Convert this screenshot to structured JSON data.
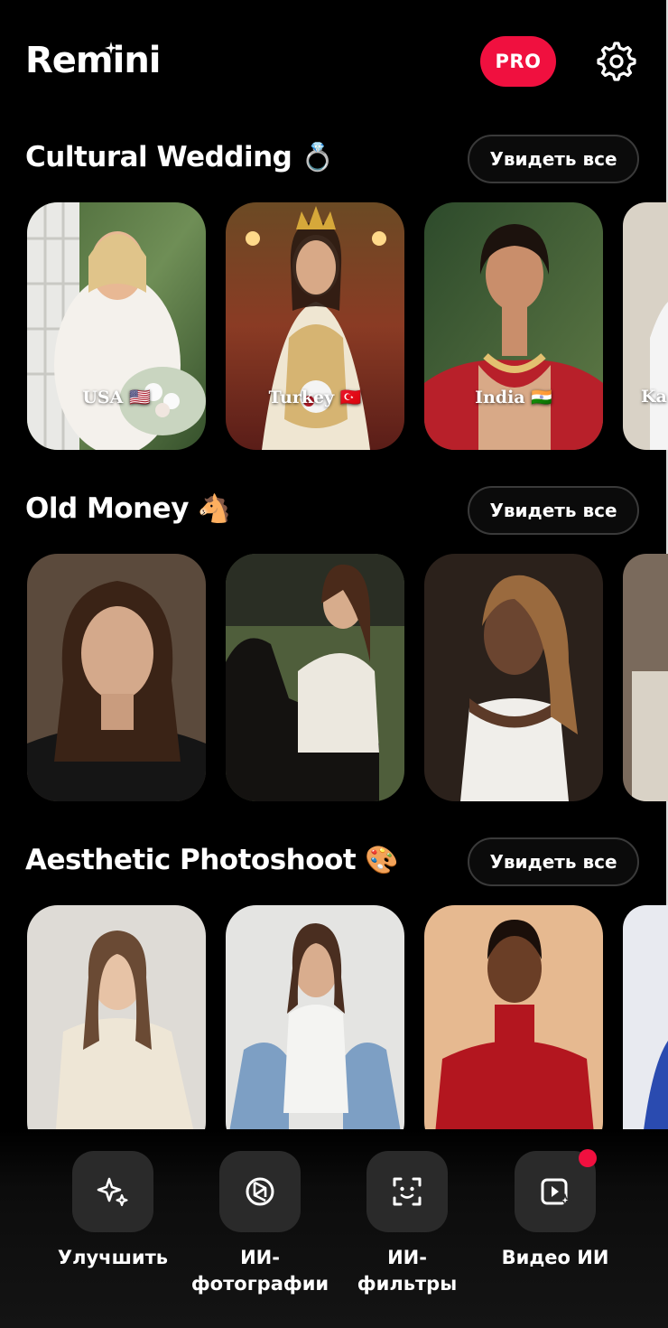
{
  "header": {
    "app_name": "Remini",
    "pro_label": "PRO",
    "settings_icon": "gear-icon"
  },
  "sections": [
    {
      "title": "Cultural Wedding",
      "emoji": "💍",
      "see_all": "Увидеть все",
      "cards": [
        {
          "label": "USA 🇺🇸"
        },
        {
          "label": "Turkey 🇹🇷"
        },
        {
          "label": "India 🇮🇳"
        },
        {
          "label": "Ka"
        }
      ]
    },
    {
      "title": "Old Money",
      "emoji": "🐴",
      "see_all": "Увидеть все",
      "cards": [
        {
          "label": ""
        },
        {
          "label": ""
        },
        {
          "label": ""
        },
        {
          "label": ""
        }
      ]
    },
    {
      "title": "Aesthetic Photoshoot",
      "emoji": "🎨",
      "see_all": "Увидеть все",
      "cards": [
        {
          "label": ""
        },
        {
          "label": ""
        },
        {
          "label": ""
        },
        {
          "label": ""
        }
      ]
    }
  ],
  "nav": [
    {
      "label": "Улучшить",
      "icon": "sparkle-icon"
    },
    {
      "label": "ИИ-фотографии",
      "label_line1": "ИИ-",
      "label_line2": "фотографии",
      "icon": "aperture-icon"
    },
    {
      "label": "ИИ-фильтры",
      "label_line1": "ИИ-",
      "label_line2": "фильтры",
      "icon": "face-scan-icon"
    },
    {
      "label": "Видео ИИ",
      "icon": "video-sparkle-icon",
      "has_notification_dot": true
    }
  ],
  "colors": {
    "background": "#000000",
    "accent": "#f0103f",
    "button_bg": "#2a2a2a"
  }
}
